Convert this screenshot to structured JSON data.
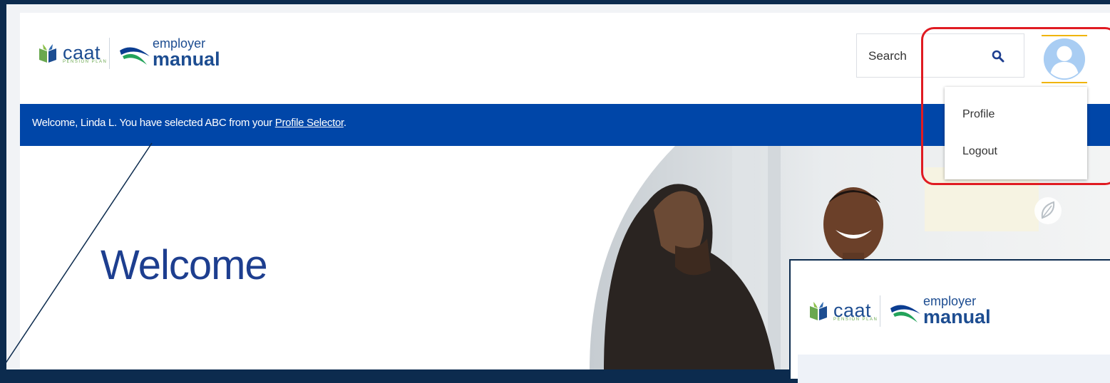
{
  "header": {
    "logo": {
      "brand": "caat",
      "plan": "PENSION PLAN",
      "product_top": "employer",
      "product_bottom": "manual"
    },
    "search": {
      "placeholder": "Search",
      "icon": "search-icon"
    },
    "avatar_icon": "user-avatar-icon"
  },
  "user_menu": {
    "items": [
      {
        "label": "Profile"
      },
      {
        "label": "Logout"
      }
    ]
  },
  "banner": {
    "text_before": "Welcome, Linda L. You have selected ABC from your ",
    "link": "Profile Selector",
    "text_after": "."
  },
  "hero": {
    "title": "Welcome"
  },
  "colors": {
    "brand_blue": "#0046a8",
    "navy": "#1d3e8f",
    "green": "#6aa84f",
    "highlight_red": "#e01b22",
    "avatar_light": "#a9cdf3",
    "avatar_accent": "#f0b400"
  },
  "inset": {
    "logo": {
      "brand": "caat",
      "plan": "PENSION PLAN",
      "product_top": "employer",
      "product_bottom": "manual"
    }
  }
}
